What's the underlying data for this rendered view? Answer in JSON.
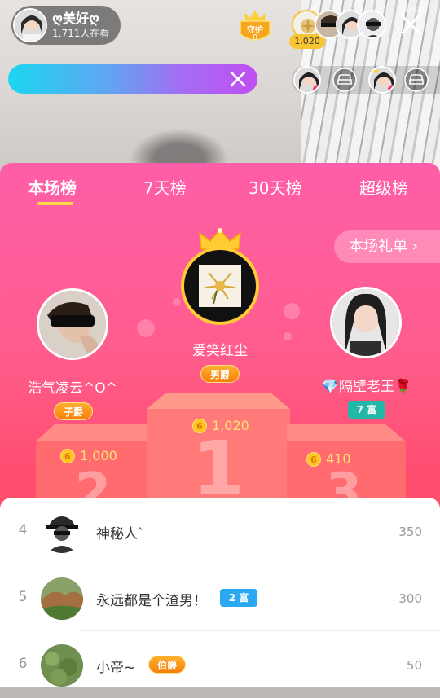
{
  "header": {
    "anchor_name": "ღ美好ღ",
    "viewers": "1,711人在看",
    "guard_label": "守护",
    "guard_count": "0",
    "top_contribution": "1,020",
    "watermark": "©cn"
  },
  "search": {
    "value": "",
    "placeholder": ""
  },
  "tabs": [
    {
      "label": "本场榜",
      "active": true
    },
    {
      "label": "7天榜",
      "active": false
    },
    {
      "label": "30天榜",
      "active": false
    },
    {
      "label": "超级榜",
      "active": false
    }
  ],
  "gift_list_button": "本场礼单 ›",
  "podium": {
    "first": {
      "name": "爱笑红尘",
      "badge": "男爵",
      "score": "1,020",
      "numeral": "1"
    },
    "second": {
      "name": "浩气凌云^O^",
      "badge": "子爵",
      "score": "1,000",
      "numeral": "2"
    },
    "third": {
      "name": "💎隔壁老王🌹",
      "badge": "7 富",
      "score": "410",
      "numeral": "3"
    }
  },
  "list": [
    {
      "rank": "4",
      "name": "神秘人`",
      "badge": "",
      "score": "350"
    },
    {
      "rank": "5",
      "name": "永远都是个渣男！",
      "badge": "2 富",
      "score": "300"
    },
    {
      "rank": "6",
      "name": "小帝~",
      "badge": "伯爵",
      "score": "50"
    }
  ],
  "colors": {
    "panel_top": "#ff5ea8",
    "panel_bottom": "#ff5a5f",
    "gold": "#ffc521",
    "tab_underline": "#ffd54a",
    "rich_badge": "#22b8a8",
    "rich_badge_blue": "#2aa8f2"
  },
  "icons": [
    "crown-icon",
    "close-icon",
    "clear-icon",
    "sofa-icon",
    "coin-icon",
    "chevron-right-icon"
  ]
}
